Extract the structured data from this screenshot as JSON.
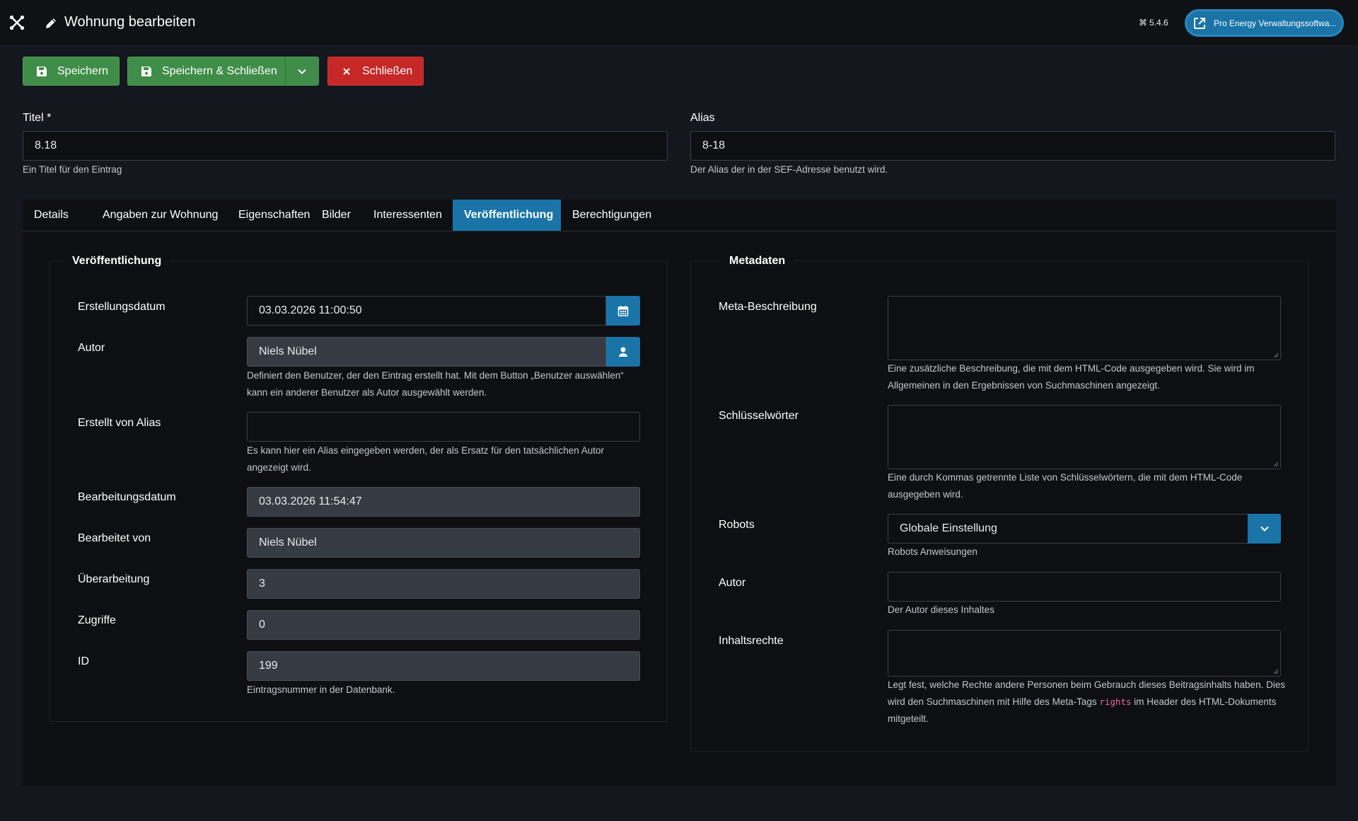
{
  "header": {
    "title": "Wohnung bearbeiten",
    "version": "5.4.6",
    "site_button": "Pro Energy Verwaltungssoftwa..."
  },
  "toolbar": {
    "save": "Speichern",
    "save_close": "Speichern & Schließen",
    "close": "Schließen"
  },
  "title_field": {
    "label": "Titel *",
    "value": "8.18",
    "hint": "Ein Titel für den Eintrag"
  },
  "alias_field": {
    "label": "Alias",
    "value": "8-18",
    "hint": "Der Alias der in der SEF-Adresse benutzt wird."
  },
  "tabs": [
    {
      "label": "Details"
    },
    {
      "label": "Angaben zur Wohnung"
    },
    {
      "label": "Eigenschaften"
    },
    {
      "label": "Bilder"
    },
    {
      "label": "Interessenten"
    },
    {
      "label": "Veröffentlichung"
    },
    {
      "label": "Berechtigungen"
    }
  ],
  "active_tab": "Veröffentlichung",
  "publishing": {
    "legend": "Veröffentlichung",
    "created": {
      "label": "Erstellungsdatum",
      "value": "03.03.2026 11:00:50"
    },
    "author": {
      "label": "Autor",
      "value": "Niels Nübel",
      "hint": "Definiert den Benutzer, der den Eintrag erstellt hat. Mit dem Button „Benutzer auswählen“ kann ein anderer Benutzer als Autor ausgewählt werden."
    },
    "created_by_alias": {
      "label": "Erstellt von Alias",
      "value": "",
      "hint": "Es kann hier ein Alias eingegeben werden, der als Ersatz für den tatsächlichen Autor angezeigt wird."
    },
    "modified": {
      "label": "Bearbeitungsdatum",
      "value": "03.03.2026 11:54:47"
    },
    "modified_by": {
      "label": "Bearbeitet von",
      "value": "Niels Nübel"
    },
    "revision": {
      "label": "Überarbeitung",
      "value": "3"
    },
    "hits": {
      "label": "Zugriffe",
      "value": "0"
    },
    "id": {
      "label": "ID",
      "value": "199",
      "hint": "Eintragsnummer in der Datenbank."
    }
  },
  "metadata": {
    "legend": "Metadaten",
    "meta_description": {
      "label": "Meta-Beschreibung",
      "hint": "Eine zusätzliche Beschreibung, die mit dem HTML-Code ausgegeben wird. Sie wird im Allgemeinen in den Ergebnissen von Suchmaschinen angezeigt."
    },
    "keywords": {
      "label": "Schlüsselwörter",
      "hint": "Eine durch Kommas getrennte Liste von Schlüsselwörtern, die mit dem HTML-Code ausgegeben wird."
    },
    "robots": {
      "label": "Robots",
      "value": "Globale Einstellung",
      "hint": "Robots Anweisungen"
    },
    "author": {
      "label": "Autor",
      "value": "",
      "hint": "Der Autor dieses Inhaltes"
    },
    "rights": {
      "label": "Inhaltsrechte",
      "hint_part1": "Legt fest, welche Rechte andere Personen beim Gebrauch dieses Beitragsinhalts haben. Dies wird den Suchmaschinen mit Hilfe des Meta-Tags ",
      "hint_code": "rights",
      "hint_part2": " im Header des HTML-Dokuments mitgeteilt."
    }
  },
  "colors": {
    "accent": "#1a74a8",
    "success": "#3f8d48",
    "danger": "#c52827",
    "background": "#14171d"
  },
  "icons": {
    "logo": "joomla-logo-icon",
    "edit": "pencil-icon",
    "save": "floppy-icon",
    "close": "x-icon",
    "calendar": "calendar-icon",
    "user": "user-icon",
    "external": "external-link-icon",
    "dropdown": "chevron-down-icon"
  }
}
